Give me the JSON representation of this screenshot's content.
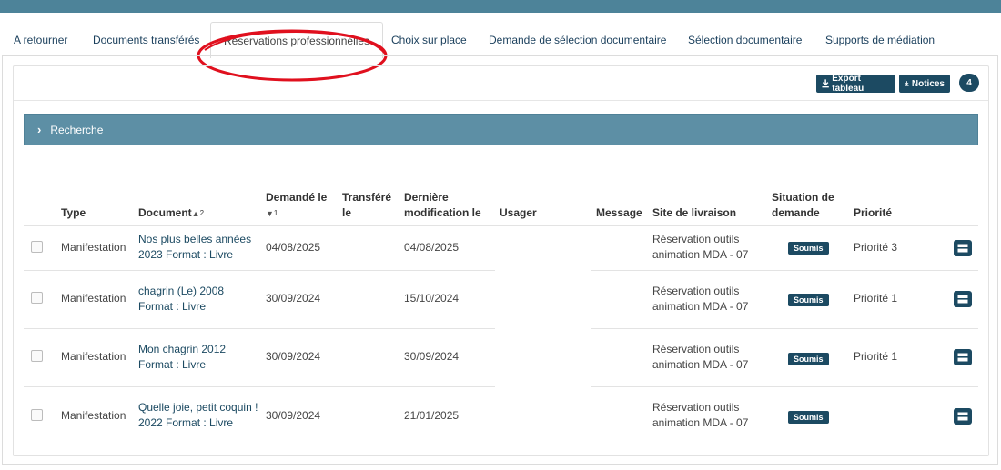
{
  "tabs": [
    {
      "label": "A retourner"
    },
    {
      "label": "Documents transférés"
    },
    {
      "label": "Réservations professionnelles"
    },
    {
      "label": "Choix sur place"
    },
    {
      "label": "Demande de sélection documentaire"
    },
    {
      "label": "Sélection documentaire"
    },
    {
      "label": "Supports de médiation"
    }
  ],
  "active_tab": "Réservations professionnelles",
  "toolbar": {
    "export_label": "Export tableau",
    "notices_label": "Notices",
    "count": "4"
  },
  "search": {
    "label": "Recherche"
  },
  "table": {
    "columns": {
      "type": "Type",
      "document": "Document",
      "document_sort_order": "2",
      "demande_line1": "Demandé le",
      "demande_sort_order": "1",
      "transfere_line1": "Transféré",
      "transfere_line2": "le",
      "derniere_line1": "Dernière",
      "derniere_line2": "modification le",
      "usager": "Usager",
      "message": "Message",
      "site": "Site de livraison",
      "situation_line1": "Situation de",
      "situation_line2": "demande",
      "priorite": "Priorité"
    },
    "rows": [
      {
        "type": "Manifestation",
        "doc_line1": "Nos plus belles années",
        "doc_line2": "2023 Format : Livre",
        "demande": "04/08/2025",
        "transfere": "",
        "derniere": "04/08/2025",
        "usager": "",
        "message": "",
        "site_line1": "Réservation outils",
        "site_line2": "animation MDA - 07",
        "situation": "Soumis",
        "priorite": "Priorité 3"
      },
      {
        "type": "Manifestation",
        "doc_line1": "chagrin (Le) 2008",
        "doc_line2": "Format : Livre",
        "demande": "30/09/2024",
        "transfere": "",
        "derniere": "15/10/2024",
        "usager": "",
        "message": "",
        "site_line1": "Réservation outils",
        "site_line2": "animation MDA - 07",
        "situation": "Soumis",
        "priorite": "Priorité 1"
      },
      {
        "type": "Manifestation",
        "doc_line1": "Mon chagrin 2012",
        "doc_line2": "Format : Livre",
        "demande": "30/09/2024",
        "transfere": "",
        "derniere": "30/09/2024",
        "usager": "",
        "message": "",
        "site_line1": "Réservation outils",
        "site_line2": "animation MDA - 07",
        "situation": "Soumis",
        "priorite": "Priorité 1"
      },
      {
        "type": "Manifestation",
        "doc_line1": "Quelle joie, petit coquin !",
        "doc_line2": "2022 Format : Livre",
        "demande": "30/09/2024",
        "transfere": "",
        "derniere": "21/01/2025",
        "usager": "",
        "message": "",
        "site_line1": "Réservation outils",
        "site_line2": "animation MDA - 07",
        "situation": "Soumis",
        "priorite": ""
      }
    ]
  },
  "colors": {
    "accent": "#1c4a62",
    "header_bar": "#4d8399",
    "search_bar": "#5d8fa5",
    "annotation": "#e0101e"
  },
  "icons": {
    "export": "download-icon",
    "notices": "download-icon",
    "search": "chevron-right-icon",
    "row_action": "details-icon"
  }
}
